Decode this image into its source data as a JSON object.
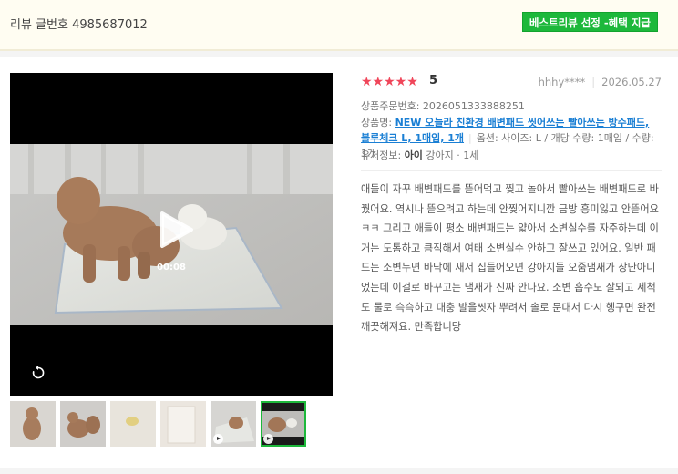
{
  "header": {
    "review_number": "리뷰 글번호 4985687012",
    "best_badge": "베스트리뷰 선정 -혜택 지급"
  },
  "player": {
    "duration": "00:08"
  },
  "thumbnails": [
    {
      "has_video": false,
      "active": false
    },
    {
      "has_video": false,
      "active": false
    },
    {
      "has_video": false,
      "active": false
    },
    {
      "has_video": false,
      "active": false
    },
    {
      "has_video": true,
      "active": false
    },
    {
      "has_video": true,
      "active": true
    }
  ],
  "review": {
    "stars": "★★★★★",
    "score": "5",
    "author": "hhhy****",
    "date": "2026.05.27",
    "order_no": "상품주문번호: 2026051333888251",
    "product_label": "상품명: ",
    "product_name": "NEW 오늘라 친환경 배변패드 씻어쓰는 빨아쓰는 방수패드, 블루체크 L, 1매입, 1개",
    "option": "옵션: 사이즈: L / 개당 수량: 1매입 / 수량: 1개",
    "pet_label": "유저정보: ",
    "pet_name": "아이",
    "pet_info": " 강아지 · 1세",
    "content": "애들이 자꾸 배변패드를 뜯어먹고 찢고 놀아서 빨아쓰는 배변패드로 바꿨어요. 역시나 뜯으려고 하는데 안찢어지니깐 금방 흥미잃고 안뜯어요 ㅋㅋ 그리고 애들이 평소 배변패드는 얇아서 소변실수를 자주하는데 이거는 도톰하고 큼직해서 여태 소변실수 안하고 잘쓰고 있어요. 일반 패드는 소변누면 바닥에 새서 집들어오면 강아지들 오줌냄새가 장난아니었는데 이걸로 바꾸고는 냄새가 진짜 안나요. 소변 흡수도 잘되고 세척도 물로 슥슥하고 대충 발을씻자 뿌려서 솔로 문대서 다시 헹구면 완전 깨끗해져요. 만족합니당"
  },
  "colors": {
    "accent_green": "#1db83b",
    "star_red": "#f0465a",
    "link_blue": "#1a7fd4"
  }
}
